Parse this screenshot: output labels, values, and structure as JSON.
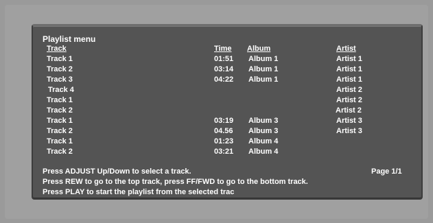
{
  "playlist": {
    "title": "Playlist menu",
    "headers": {
      "track": "Track",
      "time": "Time",
      "album": "Album",
      "artist": "Artist"
    },
    "rows": [
      {
        "track": "Track 1",
        "time": "01:51",
        "album": "Album 1",
        "artist": "Artist 1"
      },
      {
        "track": "Track 2",
        "time": "03:14",
        "album": "Album 1",
        "artist": "Artist 1"
      },
      {
        "track": "Track 3",
        "time": "04:22",
        "album": "Album 1",
        "artist": "Artist 1"
      },
      {
        "track": "Track 4",
        "time": "",
        "album": "",
        "artist": "Artist 2"
      },
      {
        "track": "Track 1",
        "time": "",
        "album": "",
        "artist": "Artist 2"
      },
      {
        "track": "Track 2",
        "time": "",
        "album": "",
        "artist": "Artist 2"
      },
      {
        "track": "Track 1",
        "time": "03:19",
        "album": "Album 3",
        "artist": "Artist 3"
      },
      {
        "track": "Track 2",
        "time": "04.56",
        "album": "Album 3",
        "artist": "Artist 3"
      },
      {
        "track": "Track 1",
        "time": "01:23",
        "album": "Album 4",
        "artist": ""
      },
      {
        "track": "Track 2",
        "time": "03:21",
        "album": "Album 4",
        "artist": ""
      }
    ],
    "page_indicator": "Page 1/1",
    "instructions": [
      "Press ADJUST Up/Down to select a track.",
      "Press REW to go to the top track, press FF/FWD to go to the bottom track.",
      "Press PLAY to start the playlist from the selected trac"
    ]
  }
}
